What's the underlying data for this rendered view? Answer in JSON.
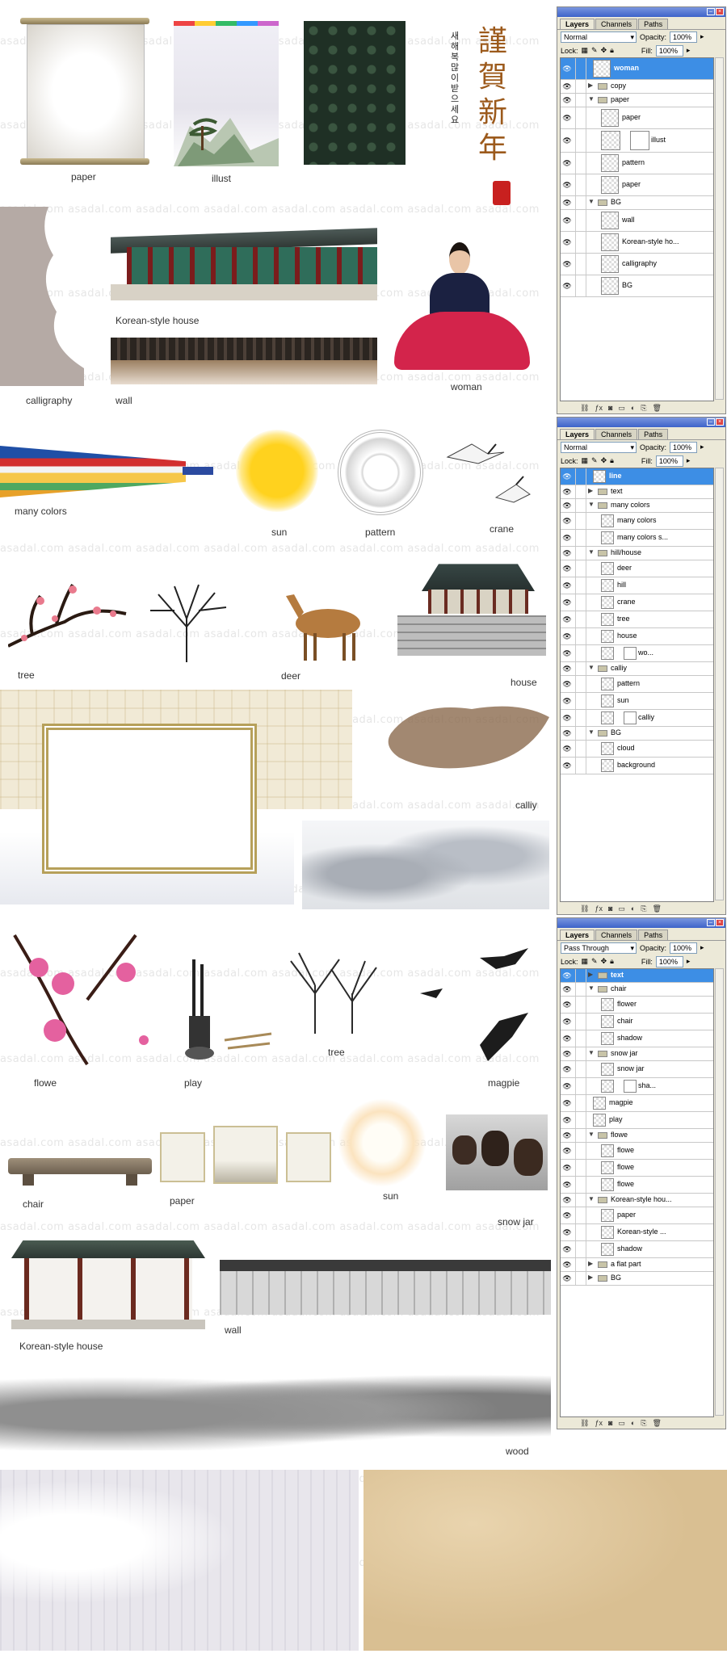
{
  "watermark": "asadal.com",
  "labels": {
    "paper1": "paper",
    "illust": "illust",
    "calligraphy": "calligraphy",
    "wall1": "wall",
    "korean_house1": "Korean-style house",
    "woman": "woman",
    "many_colors": "many colors",
    "sun1": "sun",
    "pattern": "pattern",
    "crane": "crane",
    "tree1": "tree",
    "deer": "deer",
    "house": "house",
    "calliy": "calliy",
    "flowe": "flowe",
    "play": "play",
    "tree2": "tree",
    "magpie": "magpie",
    "chair": "chair",
    "paper2": "paper",
    "sun2": "sun",
    "snow_jar": "snow jar",
    "korean_house2": "Korean-style house",
    "wall2": "wall",
    "wood": "wood"
  },
  "greeting": {
    "large": "謹賀新年",
    "small": "새해 복 많이 받으세요"
  },
  "panel1": {
    "tabs": [
      "Layers",
      "Channels",
      "Paths"
    ],
    "blend": "Normal",
    "opacity_label": "Opacity:",
    "opacity": "100%",
    "lock_label": "Lock:",
    "fill_label": "Fill:",
    "fill": "100%",
    "layers": [
      "woman",
      "copy",
      "paper",
      "paper",
      "illust",
      "pattern",
      "paper",
      "BG",
      "wall",
      "Korean-style ho...",
      "calligraphy",
      "BG"
    ]
  },
  "panel2": {
    "tabs": [
      "Layers",
      "Channels",
      "Paths"
    ],
    "blend": "Normal",
    "opacity_label": "Opacity:",
    "opacity": "100%",
    "lock_label": "Lock:",
    "fill_label": "Fill:",
    "fill": "100%",
    "layers": [
      "line",
      "text",
      "many colors",
      "many colors",
      "many colors s...",
      "hill/house",
      "deer",
      "hill",
      "crane",
      "tree",
      "house",
      "wo...",
      "calliy",
      "pattern",
      "sun",
      "calliy",
      "BG",
      "cloud",
      "background"
    ]
  },
  "panel3": {
    "tabs": [
      "Layers",
      "Channels",
      "Paths"
    ],
    "blend": "Pass Through",
    "opacity_label": "Opacity:",
    "opacity": "100%",
    "lock_label": "Lock:",
    "fill_label": "Fill:",
    "fill": "100%",
    "layers": [
      "text",
      "chair",
      "flower",
      "chair",
      "shadow",
      "snow jar",
      "snow jar",
      "sha...",
      "magpie",
      "play",
      "flowe",
      "flowe",
      "flowe",
      "flowe",
      "Korean-style hou...",
      "paper",
      "Korean-style ...",
      "shadow",
      "a flat part",
      "BG"
    ]
  },
  "colors": {
    "selection": "#3d8ee5",
    "panel_bg": "#ece9d8",
    "titlebar": "#3d63c9"
  }
}
